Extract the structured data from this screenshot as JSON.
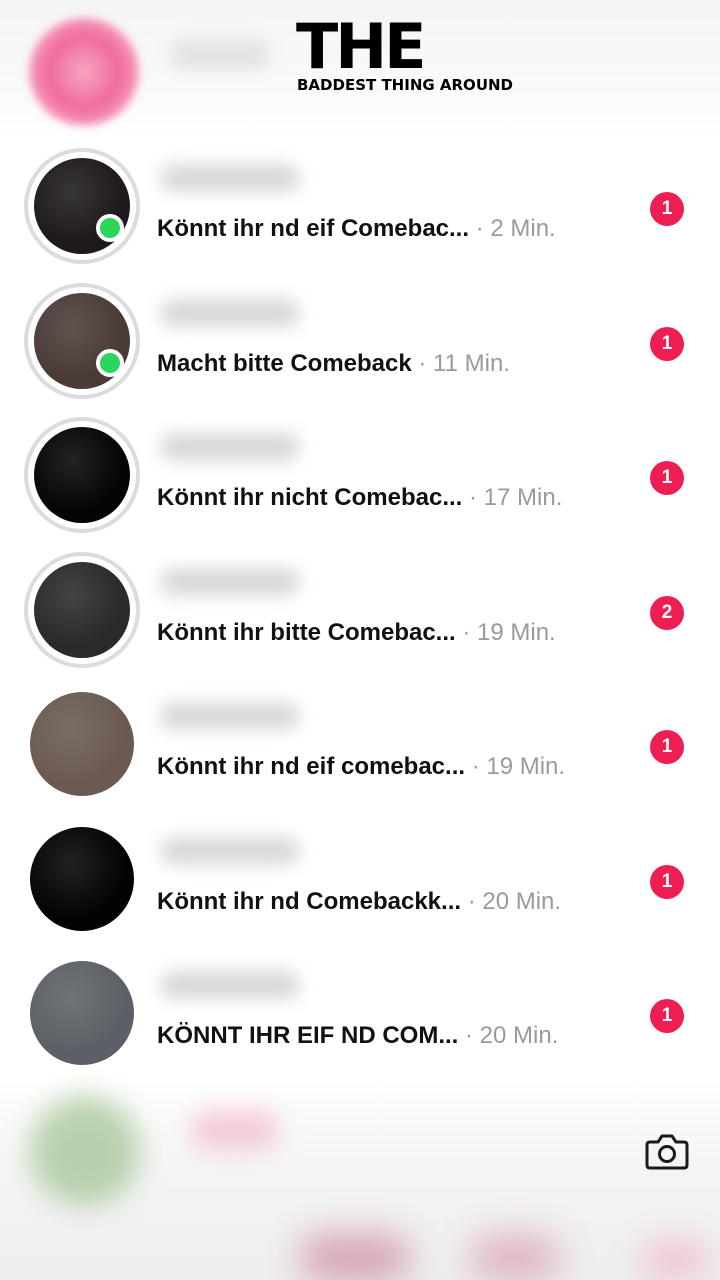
{
  "overlay": {
    "title": "THE",
    "subtitle": "BADDEST THING AROUND"
  },
  "chats": [
    {
      "message": "Könnt ihr nd eif Comebac...",
      "time": "· 2 Min.",
      "unread": "1",
      "online": true,
      "ring": true,
      "avatar_color": "#1e1a1c"
    },
    {
      "message": "Macht bitte Comeback",
      "time": "· 11 Min.",
      "unread": "1",
      "online": true,
      "ring": true,
      "avatar_color": "#4a3b37"
    },
    {
      "message": "Könnt ihr nicht Comebac...",
      "time": "· 17 Min.",
      "unread": "1",
      "online": false,
      "ring": true,
      "avatar_color": "#050505"
    },
    {
      "message": "Könnt ihr bitte Comebac...",
      "time": "· 19 Min.",
      "unread": "2",
      "online": false,
      "ring": true,
      "avatar_color": "#2a2a2a"
    },
    {
      "message": "Könnt ihr nd eif comebac...",
      "time": "· 19 Min.",
      "unread": "1",
      "online": false,
      "ring": false,
      "avatar_color": "#6a5a50"
    },
    {
      "message": "Könnt ihr nd Comebackk...",
      "time": "· 20 Min.",
      "unread": "1",
      "online": false,
      "ring": false,
      "avatar_color": "#030303"
    },
    {
      "message": "KÖNNT IHR EIF ND COM...",
      "time": "· 20 Min.",
      "unread": "1",
      "online": false,
      "ring": false,
      "avatar_color": "#5c6066"
    }
  ],
  "icons": {
    "camera": "camera-icon"
  },
  "colors": {
    "badge": "#ee1d52",
    "online": "#2bd65a"
  }
}
